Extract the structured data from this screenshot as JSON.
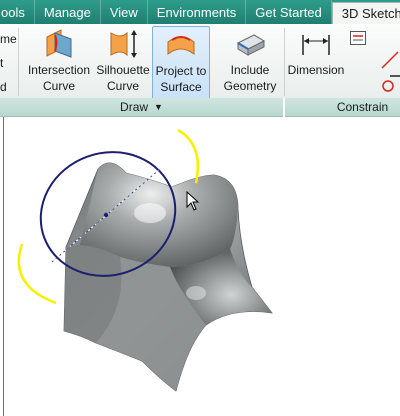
{
  "menubar": {
    "tabs": [
      {
        "label": "Tools",
        "visible_label": "ools"
      },
      {
        "label": "Manage"
      },
      {
        "label": "View"
      },
      {
        "label": "Environments"
      },
      {
        "label": "Get Started"
      },
      {
        "label": "3D Sketch",
        "active": true
      }
    ],
    "accent_color": "#2f9c8b"
  },
  "ribbon": {
    "left_cut_labels": [
      "me",
      "t",
      "d"
    ],
    "draw_panel": {
      "buttons": [
        {
          "line1": "Intersection",
          "line2": "Curve",
          "icon": "intersection-curve-icon"
        },
        {
          "line1": "Silhouette",
          "line2": "Curve",
          "icon": "silhouette-curve-icon"
        },
        {
          "line1": "Project to",
          "line2": "Surface",
          "icon": "project-to-surface-icon",
          "highlighted": true
        },
        {
          "line1": "Include",
          "line2": "Geometry",
          "icon": "include-geometry-icon"
        }
      ],
      "label": "Draw"
    },
    "constrain_panel": {
      "buttons": [
        {
          "line1": "Dimension",
          "icon": "dimension-icon"
        }
      ],
      "label": "Constrain"
    }
  },
  "viewport": {
    "background": "#ffffff",
    "model_color": "#8e9293",
    "ellipse_color": "#1c1f6e",
    "arc_color": "#f5f000"
  }
}
